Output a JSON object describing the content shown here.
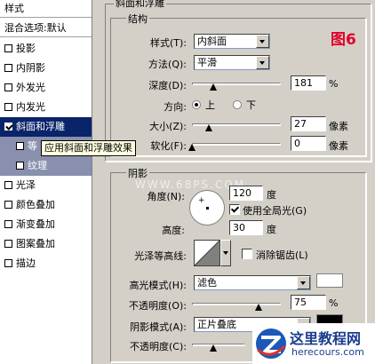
{
  "sidebar": {
    "header": "样式",
    "blend_label": "混合选项:默认",
    "items": [
      {
        "label": "投影",
        "checked": false
      },
      {
        "label": "内阴影",
        "checked": false
      },
      {
        "label": "外发光",
        "checked": false
      },
      {
        "label": "内发光",
        "checked": false
      },
      {
        "label": "斜面和浮雕",
        "checked": true,
        "selected": true
      },
      {
        "label": "等",
        "checked": false,
        "sub": true
      },
      {
        "label": "纹理",
        "checked": false,
        "sub": true
      },
      {
        "label": "光泽",
        "checked": false
      },
      {
        "label": "颜色叠加",
        "checked": false
      },
      {
        "label": "渐变叠加",
        "checked": false
      },
      {
        "label": "图案叠加",
        "checked": false
      },
      {
        "label": "描边",
        "checked": false
      }
    ],
    "tooltip": "应用斜面和浮雕效果"
  },
  "bevel": {
    "title": "斜面和浮雕",
    "structure_title": "结构",
    "figure_label": "图6",
    "style_label": "样式(T):",
    "style_value": "内斜面",
    "technique_label": "方法(Q):",
    "technique_value": "平滑",
    "depth_label": "深度(D):",
    "depth_value": "181",
    "depth_unit": "%",
    "direction_label": "方向:",
    "dir_up": "上",
    "dir_down": "下",
    "size_label": "大小(Z):",
    "size_value": "27",
    "size_unit": "像素",
    "soften_label": "软化(F):",
    "soften_value": "0",
    "soften_unit": "像素"
  },
  "shading": {
    "title": "阴影",
    "watermark": "WWW.68PS.COM",
    "angle_label": "角度(N):",
    "angle_value": "120",
    "angle_unit": "度",
    "global_light_label": "使用全局光(G)",
    "altitude_label": "高度:",
    "altitude_value": "30",
    "altitude_unit": "度",
    "gloss_label": "光泽等高线:",
    "antialias_label": "消除锯齿(L)",
    "highlight_mode_label": "高光模式(H):",
    "highlight_mode_value": "滤色",
    "highlight_color": "#ffffff",
    "highlight_opacity_label": "不透明度(O):",
    "highlight_opacity_value": "75",
    "opacity_unit": "%",
    "shadow_mode_label": "阴影模式(A):",
    "shadow_mode_value": "正片叠底",
    "shadow_color": "#000000",
    "shadow_opacity_label": "不透明度(C):"
  },
  "logo": {
    "name": "这里教程网",
    "url": "herecours.com"
  }
}
